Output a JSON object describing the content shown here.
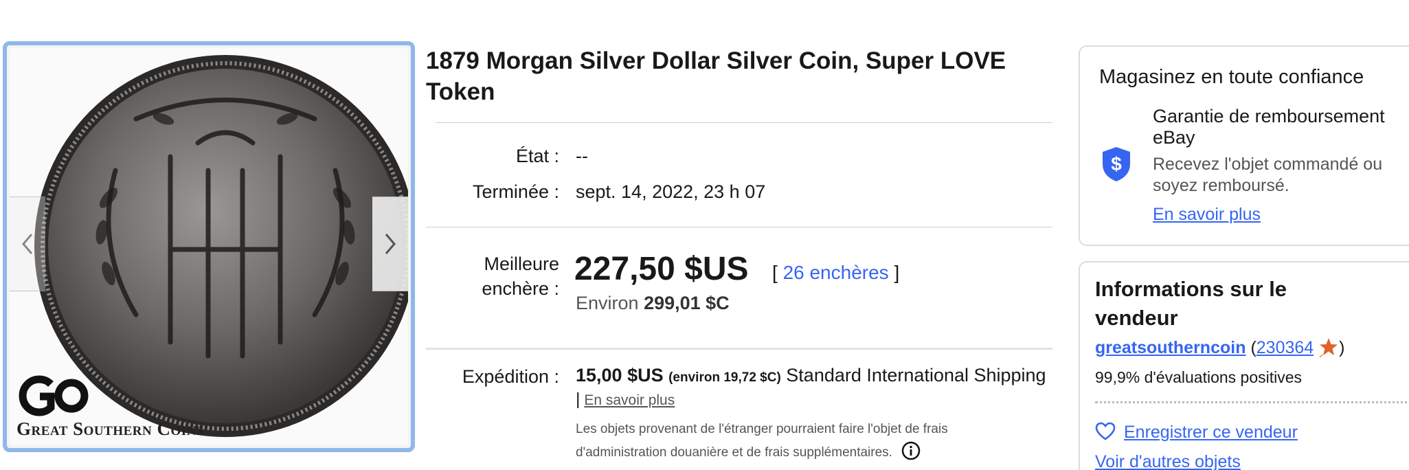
{
  "gallery": {
    "brand_name": "Great Southern Coins",
    "brand_logo": "GC-monogram-logo",
    "prev_icon": "chevron-left-icon",
    "next_icon": "chevron-right-icon"
  },
  "listing": {
    "title": "1879 Morgan Silver Dollar Silver Coin, Super LOVE Token",
    "condition_label": "État :",
    "condition_value": "--",
    "ended_label": "Terminée :",
    "ended_value": "sept. 14, 2022, 23 h 07",
    "bid_label_line1": "Meilleure",
    "bid_label_line2": "enchère :",
    "price": "227,50 $US",
    "bids_open": "[",
    "bids_link": "26 enchères",
    "bids_close": "]",
    "approx_prefix": "Environ",
    "approx_value": "299,01 $C",
    "shipping_label": "Expédition :",
    "shipping_price": "15,00 $US",
    "shipping_approx": "(environ 19,72 $C)",
    "shipping_service": "Standard International Shipping",
    "shipping_sep": "|",
    "shipping_more": "En savoir plus",
    "customs_note": "Les objets provenant de l'étranger pourraient faire l'objet de frais d'administration douanière et de frais supplémentaires.",
    "info_icon": "info-circle-icon"
  },
  "confidence": {
    "heading": "Magasinez en toute confiance",
    "guarantee_title": "Garantie de remboursement eBay",
    "guarantee_desc": "Recevez l'objet commandé ou soyez remboursé.",
    "more_link": "En savoir plus",
    "icon": "shield-dollar-icon",
    "accent": "#3665f3"
  },
  "seller": {
    "heading": "Informations sur le vendeur",
    "name": "greatsoutherncoin",
    "feedback_open": "(",
    "feedback_score": "230364",
    "feedback_close": ")",
    "star_icon": "feedback-star-icon",
    "positive": "99,9% d'évaluations positives",
    "save_label": "Enregistrer ce vendeur",
    "save_icon": "heart-icon",
    "more_items": "Voir d'autres objets"
  }
}
